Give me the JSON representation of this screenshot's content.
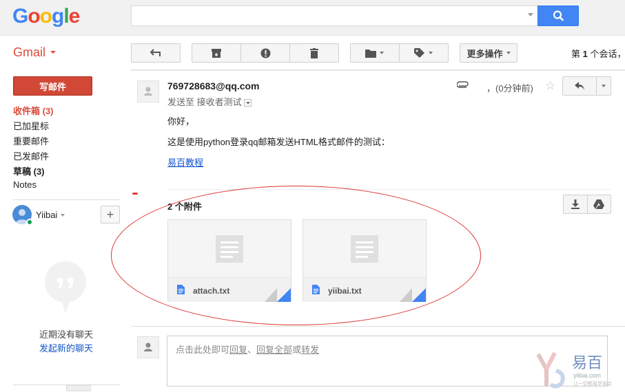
{
  "header": {
    "logo_letters": [
      "G",
      "o",
      "o",
      "g",
      "l",
      "e"
    ]
  },
  "toolbar": {
    "app_name": "Gmail",
    "more_actions": "更多操作",
    "conv_prefix": "第",
    "conv_number": "1",
    "conv_suffix": "个会话，"
  },
  "sidebar": {
    "compose": "写邮件",
    "items": [
      {
        "label": "收件箱 (3)"
      },
      {
        "label": "已加星标"
      },
      {
        "label": "重要邮件"
      },
      {
        "label": "已发邮件"
      },
      {
        "label": "草稿 (3)"
      },
      {
        "label": "Notes"
      }
    ],
    "user_name": "Yiibai",
    "no_chats": "近期没有聊天",
    "start_chat": "发起新的聊天"
  },
  "message": {
    "sender": "769728683@qq.com",
    "sent_to_prefix": "发送至",
    "recipient": "接收者测试",
    "time": "，(0分钟前)",
    "greeting": "你好，",
    "body": "这是使用python登录qq邮箱发送HTML格式邮件的测试：",
    "link": "易百教程"
  },
  "attachments": {
    "title": "2 个附件",
    "files": [
      {
        "name": "attach.txt"
      },
      {
        "name": "yiibai.txt"
      }
    ]
  },
  "reply": {
    "prefix": "点击此处即可",
    "reply": "回复",
    "sep": "、",
    "reply_all": "回复全部",
    "or": "或",
    "forward": "转发"
  },
  "watermark": {
    "name": "易百",
    "site": "yiibai.com",
    "tagline": "让一切都易学易会"
  },
  "colors": {
    "accent_red": "#dd4b39",
    "blue": "#4285f4",
    "link": "#1155cc"
  }
}
